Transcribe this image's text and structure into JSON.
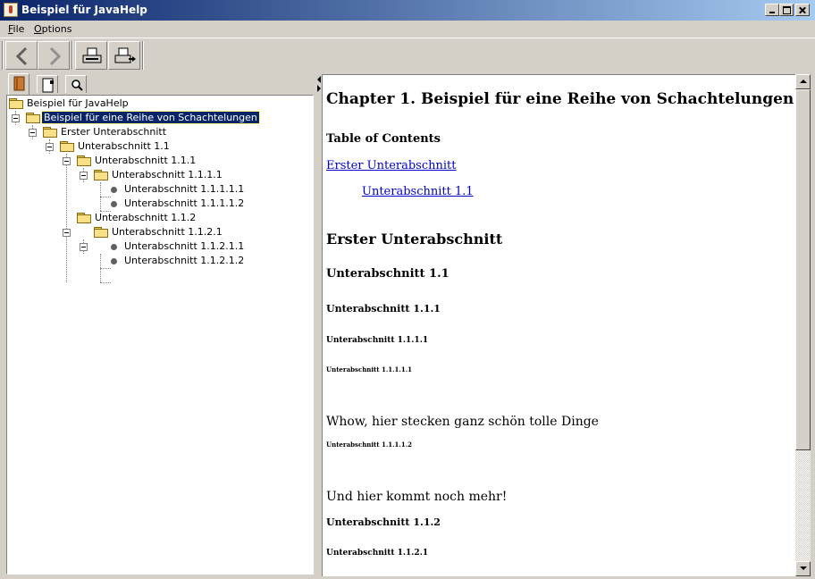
{
  "window": {
    "title": "Beispiel für JavaHelp"
  },
  "menu": {
    "items": [
      {
        "mnemonic": "F",
        "rest": "ile"
      },
      {
        "mnemonic": "O",
        "rest": "ptions"
      }
    ]
  },
  "toolbar": {
    "buttons": [
      {
        "icon": "back-arrow-icon"
      },
      {
        "icon": "forward-arrow-icon",
        "disabled": true
      },
      {
        "icon": "print-icon"
      },
      {
        "icon": "page-setup-icon"
      }
    ]
  },
  "navigator": {
    "tabs": [
      {
        "icon": "toc-book-icon",
        "active": true
      },
      {
        "icon": "index-icon"
      },
      {
        "icon": "search-magnifier-icon"
      }
    ],
    "tree": [
      {
        "label": "Beispiel für JavaHelp",
        "type": "folder"
      },
      {
        "label": "Beispiel für eine Reihe von Schachtelungen",
        "type": "folder",
        "selected": true
      },
      {
        "label": "Erster Unterabschnitt",
        "type": "folder"
      },
      {
        "label": "Unterabschnitt 1.1",
        "type": "folder"
      },
      {
        "label": "Unterabschnitt 1.1.1",
        "type": "folder"
      },
      {
        "label": "Unterabschnitt 1.1.1.1",
        "type": "folder"
      },
      {
        "label": "Unterabschnitt 1.1.1.1.1",
        "type": "leaf"
      },
      {
        "label": "Unterabschnitt 1.1.1.1.2",
        "type": "leaf"
      },
      {
        "label": "Unterabschnitt 1.1.2",
        "type": "folder"
      },
      {
        "label": "Unterabschnitt 1.1.2.1",
        "type": "folder"
      },
      {
        "label": "Unterabschnitt 1.1.2.1.1",
        "type": "leaf"
      },
      {
        "label": "Unterabschnitt 1.1.2.1.2",
        "type": "leaf"
      }
    ]
  },
  "content": {
    "chapter_title": "Chapter 1. Beispiel für eine Reihe von Schachtelungen",
    "toc_heading": "Table of Contents",
    "toc_links": [
      "Erster Unterabschnitt",
      "Unterabschnitt 1.1"
    ],
    "sections": [
      "Erster Unterabschnitt",
      "Unterabschnitt 1.1",
      "Unterabschnitt 1.1.1",
      "Unterabschnitt 1.1.1.1",
      "Unterabschnitt 1.1.1.1.1"
    ],
    "paragraph_1": "Whow, hier stecken ganz schön tolle Dinge",
    "section_11112": "Unterabschnitt 1.1.1.1.2",
    "paragraph_2": "Und hier kommt noch mehr!",
    "section_112": "Unterabschnitt 1.1.2",
    "section_1121": "Unterabschnitt 1.1.2.1"
  },
  "colors": {
    "titlebar_start": "#0a246a",
    "titlebar_end": "#a6caf0",
    "selection": "#0a246a",
    "link": "#0000cc",
    "chrome": "#d4d0c8"
  }
}
